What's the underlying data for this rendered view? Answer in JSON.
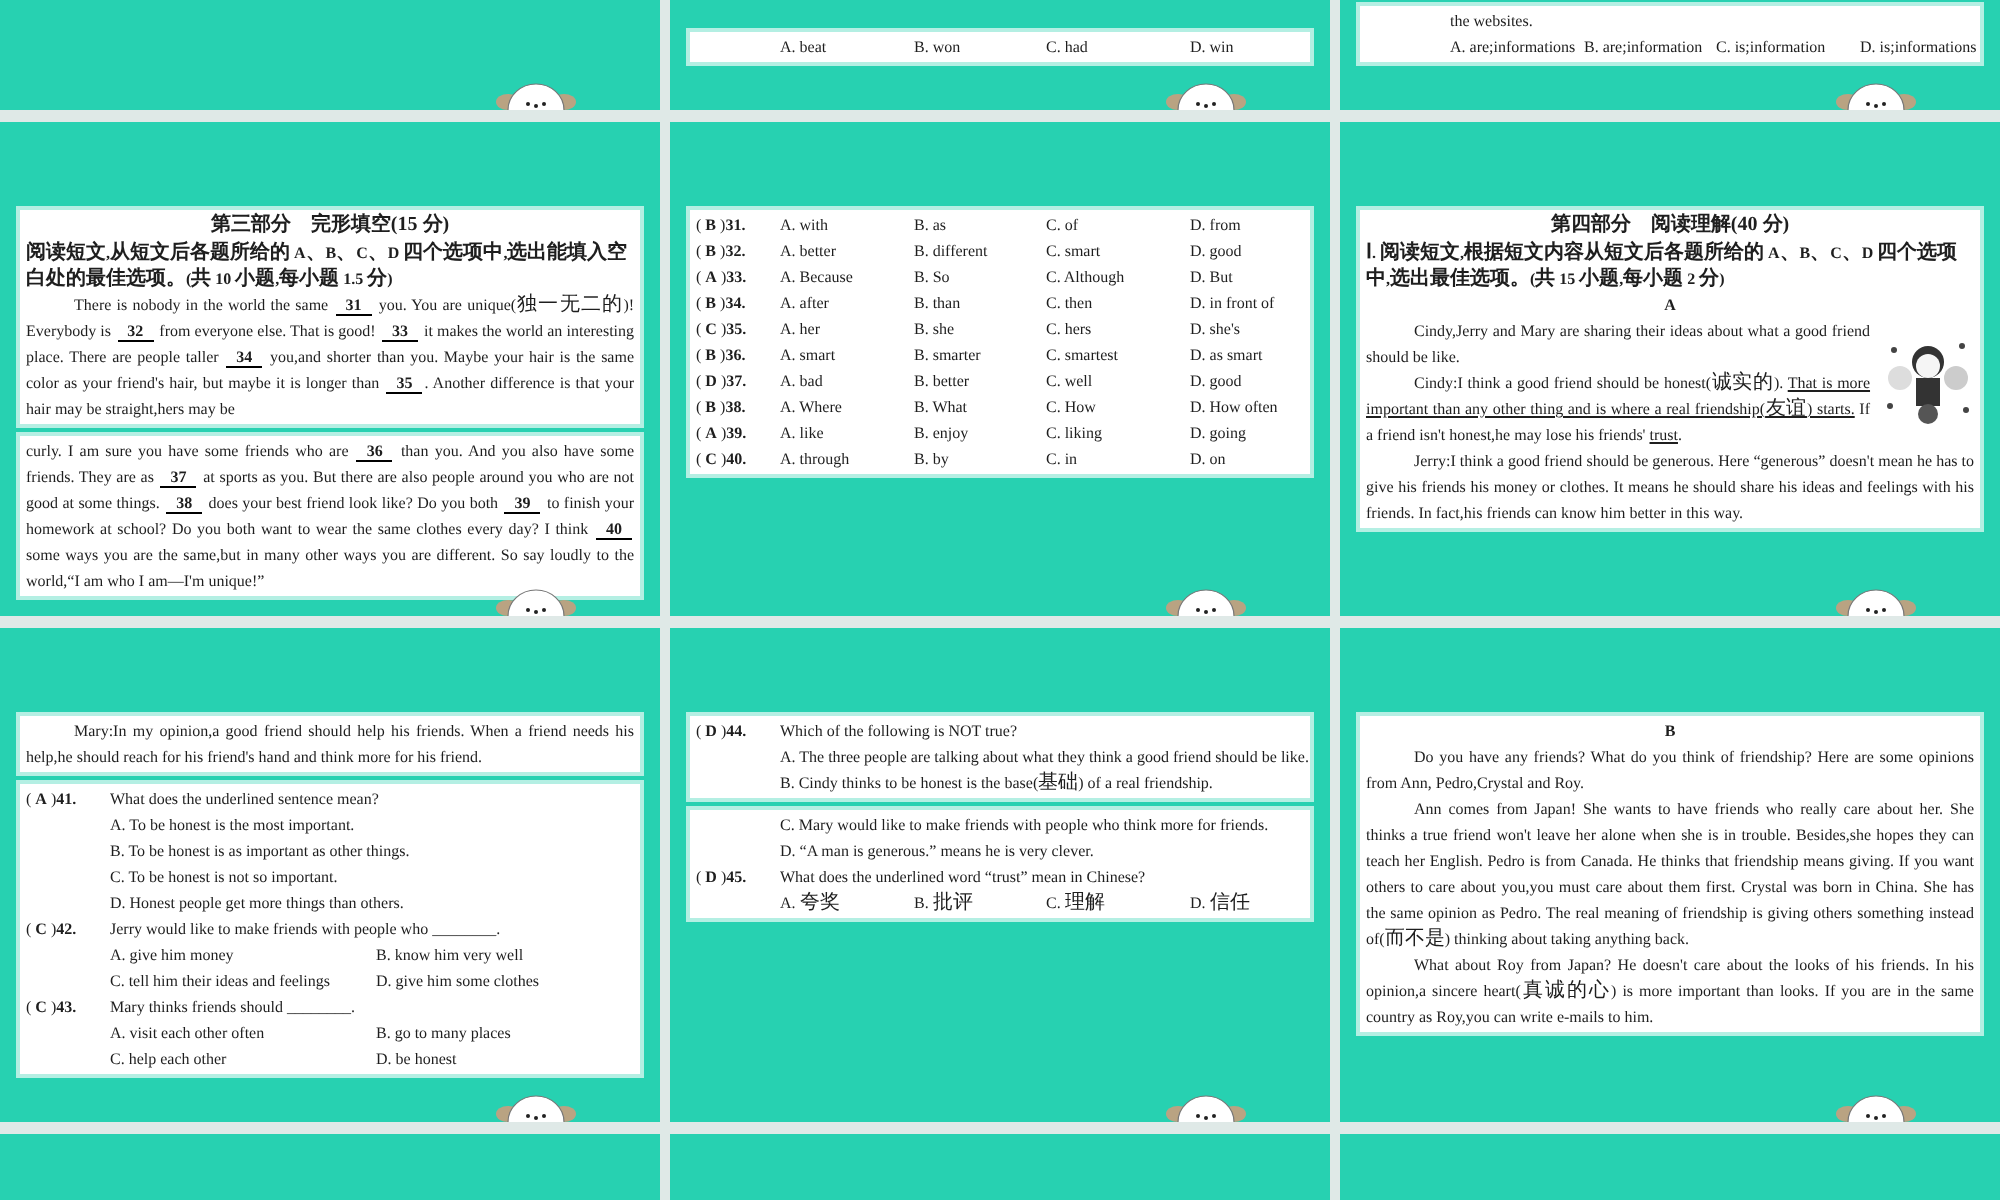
{
  "slides": [
    {
      "kind": "blank"
    },
    {
      "kind": "content",
      "panels": [
        [
          {
            "kind": "options",
            "options": [
              "A. beat",
              "B. won",
              "C. had",
              "D. win"
            ]
          }
        ]
      ]
    },
    {
      "kind": "content",
      "panels": [
        [
          {
            "kind": "indented",
            "text": "the websites."
          },
          {
            "kind": "options",
            "options": [
              "A. are;informations",
              "B. are;information",
              "C. is;information",
              "D. is;informations"
            ]
          }
        ]
      ]
    },
    {
      "kind": "content",
      "panels": [
        [
          {
            "kind": "heading",
            "text": "第三部分　完形填空(15 分)"
          },
          {
            "kind": "instruction",
            "text": "阅读短文,从短文后各题所给的 A、B、C、D 四个选项中,选出能填入空白处的最佳选项。(共 10 小题,每小题 1.5 分)"
          },
          {
            "kind": "paragraph",
            "segments": [
              {
                "kind": "text",
                "text": "There is nobody in the world the same "
              },
              {
                "kind": "blank",
                "text": "31"
              },
              {
                "kind": "text",
                "text": " you. You are unique(独一无二的)! Everybody is "
              },
              {
                "kind": "blank",
                "text": "32"
              },
              {
                "kind": "text",
                "text": " from everyone else. That is good! "
              },
              {
                "kind": "blank",
                "text": "33"
              },
              {
                "kind": "text",
                "text": " it makes the world an interesting place. There are people taller "
              },
              {
                "kind": "blank",
                "text": "34"
              },
              {
                "kind": "text",
                "text": " you,and shorter than you. Maybe your hair is the same color as your friend's hair, but maybe it is longer than "
              },
              {
                "kind": "blank",
                "text": "35"
              },
              {
                "kind": "text",
                "text": ". Another difference is that your hair may be straight,hers may be"
              }
            ]
          }
        ],
        [
          {
            "kind": "continuation",
            "segments": [
              {
                "kind": "text",
                "text": "curly. I am sure you have some friends who are "
              },
              {
                "kind": "blank",
                "text": "36"
              },
              {
                "kind": "text",
                "text": " than you. And you also have some friends. They are as "
              },
              {
                "kind": "blank",
                "text": "37"
              },
              {
                "kind": "text",
                "text": " at sports as you. But there are also people around you who are not good at some things. "
              },
              {
                "kind": "blank",
                "text": "38"
              },
              {
                "kind": "text",
                "text": " does your best friend look like? Do you both "
              },
              {
                "kind": "blank",
                "text": "39"
              },
              {
                "kind": "text",
                "text": " to finish your homework at school? Do you both want to wear the same clothes every day? I think "
              },
              {
                "kind": "blank",
                "text": "40"
              },
              {
                "kind": "text",
                "text": " some ways you are the same,but in many other ways you are different. So say loudly to the world,“I am who I am—I'm unique!”"
              }
            ]
          }
        ]
      ]
    },
    {
      "kind": "content",
      "panels": [
        [
          {
            "kind": "question",
            "label": "( **B** )**31.**",
            "options": [
              "A. with",
              "B. as",
              "C. of",
              "D. from"
            ]
          },
          {
            "kind": "question",
            "label": "( **B** )**32.**",
            "options": [
              "A. better",
              "B. different",
              "C. smart",
              "D. good"
            ]
          },
          {
            "kind": "question",
            "label": "( **A** )**33.**",
            "options": [
              "A. Because",
              "B. So",
              "C. Although",
              "D. But"
            ]
          },
          {
            "kind": "question",
            "label": "( **B** )**34.**",
            "options": [
              "A. after",
              "B. than",
              "C. then",
              "D. in front of"
            ]
          },
          {
            "kind": "question",
            "label": "( **C** )**35.**",
            "options": [
              "A. her",
              "B. she",
              "C. hers",
              "D. she's"
            ]
          },
          {
            "kind": "question",
            "label": "( **B** )**36.**",
            "options": [
              "A. smart",
              "B. smarter",
              "C. smartest",
              "D. as smart"
            ]
          },
          {
            "kind": "question",
            "label": "( **D** )**37.**",
            "options": [
              "A. bad",
              "B. better",
              "C. well",
              "D. good"
            ]
          },
          {
            "kind": "question",
            "label": "( **B** )**38.**",
            "options": [
              "A. Where",
              "B. What",
              "C. How",
              "D. How often"
            ]
          },
          {
            "kind": "question",
            "label": "( **A** )**39.**",
            "options": [
              "A. like",
              "B. enjoy",
              "C. liking",
              "D. going"
            ]
          },
          {
            "kind": "question",
            "label": "( **C** )**40.**",
            "options": [
              "A. through",
              "B. by",
              "C. in",
              "D. on"
            ]
          }
        ]
      ]
    },
    {
      "kind": "content",
      "panels": [
        [
          {
            "kind": "heading",
            "text": "第四部分　阅读理解(40 分)"
          },
          {
            "kind": "instruction",
            "text": "Ⅰ. 阅读短文,根据短文内容从短文后各题所给的 A、B、C、D 四个选项中,选出最佳选项。(共 15 小题,每小题 2 分)"
          },
          {
            "kind": "subheading",
            "text": "A"
          },
          {
            "kind": "picture_row",
            "blocks": [
              {
                "kind": "paragraph",
                "segments": [
                  {
                    "kind": "text",
                    "text": "Cindy,Jerry and Mary are sharing their ideas about what a good friend should be like."
                  }
                ]
              },
              {
                "kind": "paragraph",
                "segments": [
                  {
                    "kind": "text",
                    "text": "Cindy:I think a good friend should be honest(诚实的). "
                  },
                  {
                    "kind": "underline",
                    "text": "That is more important than any other thing and is where a real friendship(友谊) starts."
                  },
                  {
                    "kind": "text",
                    "text": " If a friend isn't honest,he may lose his friends' "
                  },
                  {
                    "kind": "underline",
                    "text": "trust"
                  },
                  {
                    "kind": "text",
                    "text": "."
                  }
                ]
              }
            ]
          },
          {
            "kind": "paragraph",
            "segments": [
              {
                "kind": "text",
                "text": "Jerry:I think a good friend should be generous. Here “generous” doesn't mean he has to give his friends his money or clothes. It means he should share his ideas and feelings with his friends. In fact,his friends can know him better in this way."
              }
            ]
          }
        ]
      ]
    },
    {
      "kind": "content",
      "panels": [
        [
          {
            "kind": "paragraph",
            "segments": [
              {
                "kind": "text",
                "text": "Mary:In my opinion,a good friend should help his friends. When a friend needs his help,he should reach for his friend's hand and think more for his friend."
              }
            ]
          }
        ],
        [
          {
            "kind": "question",
            "label": "( **A** )**41.**",
            "stem": "What does the underlined sentence mean?"
          },
          {
            "kind": "options",
            "options": [
              "A. To be honest is the most important."
            ]
          },
          {
            "kind": "options",
            "options": [
              "B. To be honest is as important as other things."
            ]
          },
          {
            "kind": "options",
            "options": [
              "C. To be honest is not so important."
            ]
          },
          {
            "kind": "options",
            "options": [
              "D. Honest people get more things than others."
            ]
          },
          {
            "kind": "question",
            "label": "( **C** )**42.**",
            "stem": "Jerry would like to make friends with people who ________."
          },
          {
            "kind": "options",
            "options": [
              "A. give him money",
              "B. know him very well"
            ]
          },
          {
            "kind": "options",
            "options": [
              "C. tell him their ideas and feelings",
              "D. give him some clothes"
            ]
          },
          {
            "kind": "question",
            "label": "( **C** )**43.**",
            "stem": "Mary thinks friends should ________."
          },
          {
            "kind": "options",
            "options": [
              "A. visit each other often",
              "B. go to many places"
            ]
          },
          {
            "kind": "options",
            "options": [
              "C. help each other",
              "D. be honest"
            ]
          }
        ]
      ]
    },
    {
      "kind": "content",
      "panels": [
        [
          {
            "kind": "question",
            "label": "( **D** )**44.**",
            "stem": "Which of the following is NOT true?"
          },
          {
            "kind": "options",
            "options": [
              "A. The three people are talking about what they think a good friend should be like."
            ]
          },
          {
            "kind": "options",
            "options": [
              "B. Cindy thinks to be honest is the base(基础) of a real friendship."
            ]
          }
        ],
        [
          {
            "kind": "options",
            "options": [
              "C. Mary would like to make friends with people who think more for friends."
            ]
          },
          {
            "kind": "options",
            "options": [
              "D. “A man is generous.” means he is very clever."
            ]
          },
          {
            "kind": "question",
            "label": "( **D** )**45.**",
            "stem": "What does the underlined word “trust” mean in Chinese?"
          },
          {
            "kind": "options",
            "options": [
              "A. 夸奖",
              "B. 批评",
              "C. 理解",
              "D. 信任"
            ]
          }
        ]
      ]
    },
    {
      "kind": "content",
      "panels": [
        [
          {
            "kind": "subheading",
            "text": "B"
          },
          {
            "kind": "paragraph",
            "segments": [
              {
                "kind": "text",
                "text": "Do you have any friends? What do you think of friendship? Here are some opinions from Ann, Pedro,Crystal and Roy."
              }
            ]
          },
          {
            "kind": "paragraph",
            "segments": [
              {
                "kind": "text",
                "text": "Ann comes from Japan! She wants to have friends who really care about her. She thinks a true friend won't leave her alone when she is in trouble. Besides,she hopes they can teach her English. Pedro is from Canada. He thinks that friendship means giving. If you want others to care about you,you must care about them first. Crystal was born in China. She has the same opinion as Pedro. The real meaning of friendship is giving others something instead of(而不是) thinking about taking anything back."
              }
            ]
          },
          {
            "kind": "paragraph",
            "segments": [
              {
                "kind": "text",
                "text": "What about Roy from Japan? He doesn't care about the looks of his friends. In his opinion,a sincere heart(真诚的心) is more important than looks. If you are in the same country as Roy,you can write e-mails to him."
              }
            ]
          }
        ]
      ]
    },
    {
      "kind": "blank"
    },
    {
      "kind": "blank"
    },
    {
      "kind": "blank"
    }
  ]
}
